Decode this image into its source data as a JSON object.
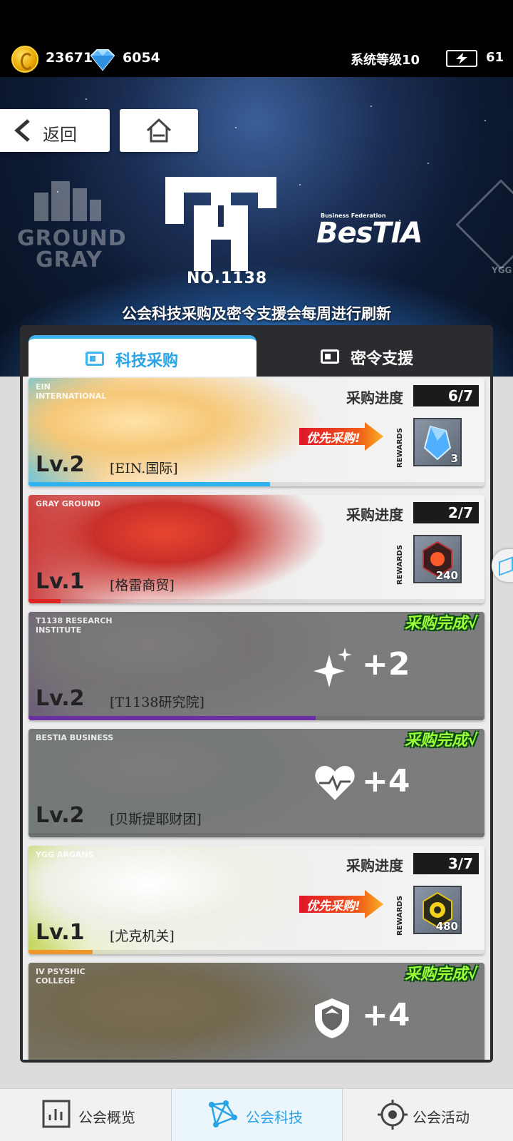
{
  "header": {
    "coins": "23671",
    "gems": "6054",
    "system_level": "系统等级10",
    "energy": "61"
  },
  "nav": {
    "back_label": "返回"
  },
  "banner": {
    "logo_left_line1": "GROUND",
    "logo_left_line2": "GRAY",
    "center_number": "NO.1138",
    "logo_right_small": "Business Federation",
    "logo_right_big": "BesTIA",
    "logo_far_right": "YGG",
    "notice": "公会科技采购及密令支援会每周进行刷新"
  },
  "tabs": [
    {
      "label": "科技采购",
      "active": true
    },
    {
      "label": "密令支援",
      "active": false
    }
  ],
  "progress_label": "采购进度",
  "rewards_label": "REWARDS",
  "priority_label": "优先采购!",
  "done_label": "采购完成√",
  "cards": [
    {
      "tag": "EIN INTERNATIONAL",
      "level": "Lv.2",
      "name": "[EIN.国际]",
      "status": "in_progress",
      "progress": "6/7",
      "progress_fraction": 0.53,
      "bar_color": "#2fb2ef",
      "reward_qty": "3",
      "reward_icon": "blue-crystal-icon"
    },
    {
      "tag": "GRAY GROUND",
      "level": "Lv.1",
      "name": "[格雷商贸]",
      "status": "in_progress",
      "progress": "2/7",
      "progress_fraction": 0.07,
      "bar_color": "#e02424",
      "reward_qty": "240",
      "reward_icon": "red-core-icon"
    },
    {
      "tag": "T1138 RESEARCH INSTITUTE",
      "level": "Lv.2",
      "name": "[T1138研究院]",
      "status": "done",
      "bonus": "+2",
      "bonus_icon": "sparkle-icon",
      "progress_fraction": 0.63,
      "bar_color": "#6a2fa0"
    },
    {
      "tag": "BESTIA BUSINESS",
      "level": "Lv.2",
      "name": "[贝斯提耶财团]",
      "status": "done",
      "bonus": "+4",
      "bonus_icon": "heart-pulse-icon",
      "progress_fraction": 0.0,
      "bar_color": "#444444"
    },
    {
      "tag": "YGG ARGANS",
      "level": "Lv.1",
      "name": "[尤克机关]",
      "status": "in_progress",
      "progress": "3/7",
      "progress_fraction": 0.14,
      "bar_color": "#f0962a",
      "reward_qty": "480",
      "reward_icon": "gold-gear-icon"
    },
    {
      "tag": "IV PSYSHIC COLLEGE",
      "level": "",
      "name": "",
      "status": "done",
      "bonus": "+4",
      "bonus_icon": "shield-icon",
      "progress_fraction": 0.0,
      "bar_color": "#444444"
    }
  ],
  "bottom_nav": [
    {
      "label": "公会概览",
      "icon": "chart-icon",
      "active": false
    },
    {
      "label": "公会科技",
      "icon": "network-icon",
      "active": true
    },
    {
      "label": "公会活动",
      "icon": "target-icon",
      "active": false
    }
  ]
}
